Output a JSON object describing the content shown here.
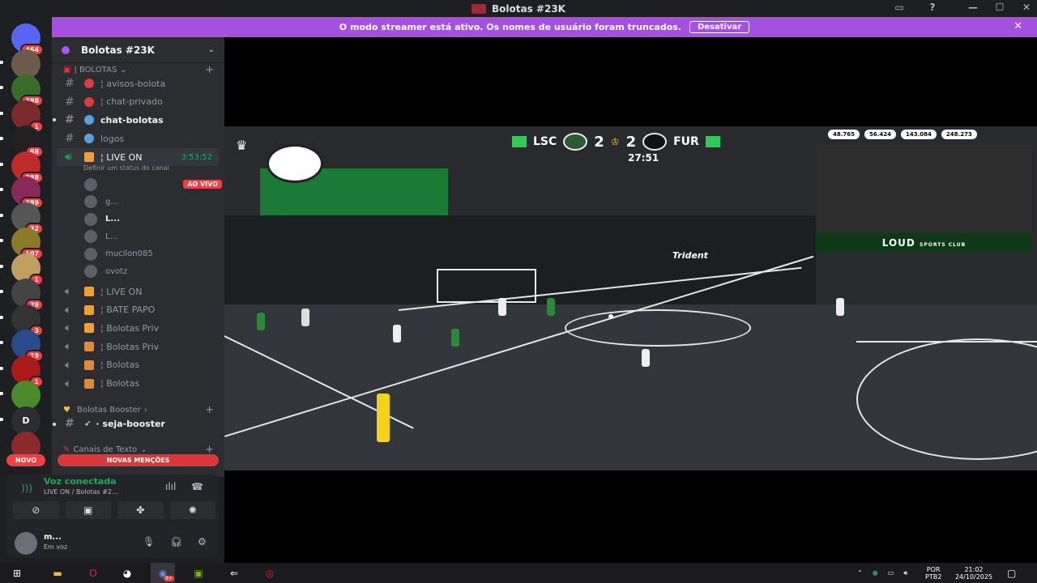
{
  "window": {
    "title": "Bolotas #23K"
  },
  "guilds": [
    {
      "name": "discord-home",
      "badge": "464",
      "color": "#5865f2"
    },
    {
      "name": "server-1",
      "badge": "",
      "color": "#6b5b4a"
    },
    {
      "name": "server-2",
      "badge": "388",
      "color": "#3a6b2a"
    },
    {
      "name": "server-3",
      "badge": "1",
      "color": "#7a2a2a"
    },
    {
      "name": "server-4",
      "badge": "68",
      "color": "#222222"
    },
    {
      "name": "server-5",
      "badge": "288",
      "color": "#c02a2a"
    },
    {
      "name": "server-6",
      "badge": "389",
      "color": "#8a2a5a"
    },
    {
      "name": "server-7",
      "badge": "32",
      "color": "#555555"
    },
    {
      "name": "server-8",
      "badge": "107",
      "color": "#8a7a2a"
    },
    {
      "name": "server-9",
      "badge": "1",
      "color": "#c0a060"
    },
    {
      "name": "server-10",
      "badge": "29",
      "color": "#444444"
    },
    {
      "name": "server-11",
      "badge": "3",
      "color": "#333333"
    },
    {
      "name": "server-12",
      "badge": "19",
      "color": "#2a4a8a"
    },
    {
      "name": "server-13",
      "badge": "1",
      "color": "#aa1a1a"
    },
    {
      "name": "server-14",
      "badge": "",
      "color": "#4a8a2a"
    },
    {
      "name": "server-d",
      "badge": "",
      "label": "D",
      "color": "#2b2d31"
    },
    {
      "name": "server-15",
      "badge": "",
      "color": "#8a2a2a"
    }
  ],
  "new_badge": "NOVO",
  "banner": {
    "text": "O modo streamer está ativo. Os nomes de usuário foram truncados.",
    "button": "Desativar"
  },
  "server": {
    "name": "Bolotas #23K"
  },
  "categories": {
    "bolotas": "| BOLOTAS",
    "booster": "Bolotas Booster",
    "text": "Canais de Texto"
  },
  "channels": [
    {
      "name": "¦ avisos-bolota",
      "emoji_color": "#d83c3e",
      "unread": false
    },
    {
      "name": "¦ chat-privado",
      "emoji_color": "#d83c3e",
      "unread": false
    },
    {
      "name": "chat-bolotas",
      "emoji_color": "#5aa0d8",
      "unread": true
    },
    {
      "name": "logos",
      "emoji_color": "#5aa0d8",
      "unread": false
    }
  ],
  "live_channel": {
    "name": "¦ LIVE ON",
    "timer": "3:53:52",
    "status": "Definir um status do canal"
  },
  "voice_users": [
    {
      "name": "",
      "live": "AO VIVO",
      "bold": false
    },
    {
      "name": "g...",
      "live": "",
      "bold": false
    },
    {
      "name": "L...",
      "live": "",
      "bold": true
    },
    {
      "name": "L...",
      "live": "",
      "bold": false
    },
    {
      "name": "mucilon085",
      "live": "",
      "bold": false
    },
    {
      "name": "ovotz",
      "live": "",
      "bold": false
    }
  ],
  "voice_channels": [
    {
      "name": "¦ LIVE ON"
    },
    {
      "name": "¦ BATE PAPO"
    },
    {
      "name": "¦ Bolotas Priv"
    },
    {
      "name": "¦ Bolotas Priv"
    },
    {
      "name": "¦ Bolotas"
    },
    {
      "name": "¦ Bolotas"
    }
  ],
  "booster_channel": {
    "name": "· seja-booster"
  },
  "mentions": "NOVAS MENÇÕES",
  "voice_panel": {
    "status": "Voz conectada",
    "location": "LIVE ON / Bolotas #2..."
  },
  "user": {
    "name": "m...",
    "status": "Em voz"
  },
  "stream": {
    "team_left": "LSC",
    "score_left": "2",
    "score_right": "2",
    "team_right": "FUR",
    "clock": "27:51",
    "stats": [
      "48.765",
      "56.424",
      "143.084",
      "248.273"
    ],
    "sponsor": "LOUD",
    "sponsor_sub": "SPORTS CLUB",
    "arena_brand": "Trident"
  },
  "taskbar": {
    "lang": "POR",
    "layout": "PTB2",
    "time": "21:02",
    "date": "24/10/2025",
    "discord_badge": "9+"
  }
}
